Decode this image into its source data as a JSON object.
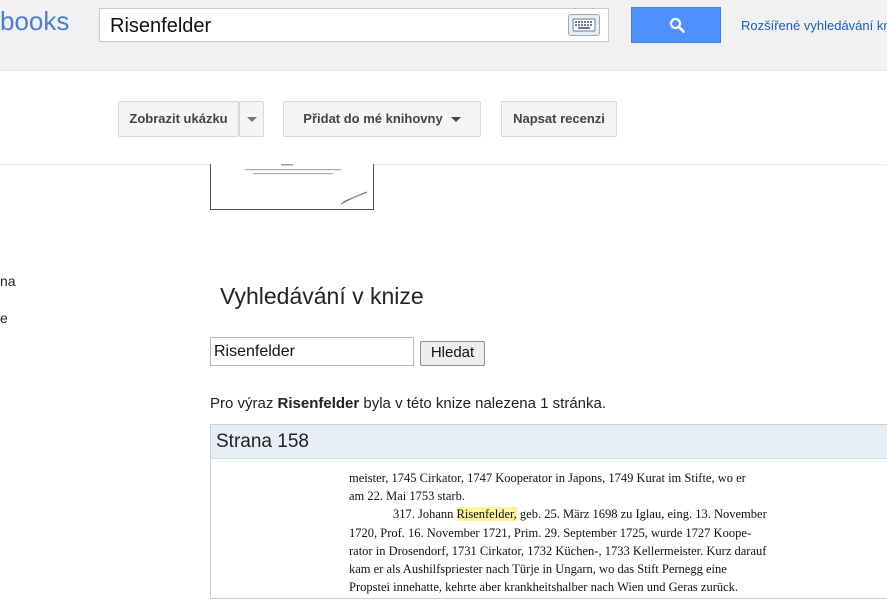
{
  "header": {
    "logo_text": "books",
    "search_value": "Risenfelder",
    "keyboard_icon": "keyboard-icon",
    "search_icon": "search-icon",
    "advanced_search_label": "Rozšířené vyhledávání kni"
  },
  "actions": {
    "preview_label": "Zobrazit ukázku",
    "add_library_label": "Přidat do mé knihovny",
    "review_label": "Napsat recenzi"
  },
  "sidebar": {
    "fragment_1": "na",
    "fragment_2": "e"
  },
  "book_search": {
    "title": "Vyhledávání v knize",
    "query_value": "Risenfelder",
    "button_label": "Hledat",
    "summary_prefix": "Pro výraz ",
    "summary_term": "Risenfelder",
    "summary_suffix": " byla v této knize nalezena 1 stránka."
  },
  "result": {
    "page_label": "Strana 158",
    "lines": {
      "l1": "meister, 1745 Cirkator, 1747 Kooperator in Japons, 1749 Kurat im Stifte, wo er",
      "l2": "am 22. Mai 1753 starb.",
      "l3_pre": "317. Johann ",
      "l3_hl": "Risenfelder,",
      "l3_post": " geb. 25. März 1698 zu Iglau, eing. 13. November",
      "l4": "1720, Prof. 16. November 1721, Prim. 29. September 1725, wurde 1727 Koope-",
      "l5": "rator in Drosendorf, 1731 Cirkator, 1732 Küchen-, 1733 Kellermeister. Kurz darauf",
      "l6": "kam er als Aushilfspriester nach Türje in Ungarn, wo das Stift Pernegg eine",
      "l7": "Propstei innehatte, kehrte aber krankheitshalber nach Wien und Geras zurück."
    }
  },
  "colors": {
    "search_button": "#4d90fe",
    "link": "#1a5fc8",
    "highlight": "#fff39a",
    "result_header": "#e8eef7"
  }
}
